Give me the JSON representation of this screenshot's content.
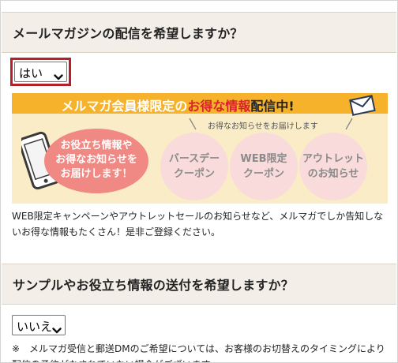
{
  "newsletter": {
    "question": "メールマガジンの配信を希望しますか？",
    "selected": "はい"
  },
  "banner": {
    "title_part1": "メルマガ会員様限定の",
    "title_part2": "お得な情報",
    "title_part3": "配信中!",
    "subtitle": "お得なお知らせをお届けします",
    "bubble_lines": [
      "お役立ち情報や",
      "お得なお知らせを",
      "お届けします！"
    ],
    "circles": [
      {
        "line1": "バースデー",
        "line2": "クーポン"
      },
      {
        "line1": "WEB限定",
        "line2": "クーポン"
      },
      {
        "line1": "アウトレット",
        "line2": "のお知らせ"
      }
    ],
    "colors": {
      "header": "#f5b22a",
      "background": "#f9ecc6",
      "bubble": "#f08883",
      "circle": "#f8dbda",
      "accent": "#d8232a"
    }
  },
  "description": "WEB限定キャンペーンやアウトレットセールのお知らせなど、メルマガでしか告知しないお得な情報もたくさん！是非ご登録ください。",
  "samples": {
    "question": "サンプルやお役立ち情報の送付を希望しますか？",
    "selected": "いいえ"
  },
  "note": "※　メルマガ受信と郵送DMのご希望については、お客様のお切替えのタイミングにより配信の予約がなされていない場合がございます。"
}
